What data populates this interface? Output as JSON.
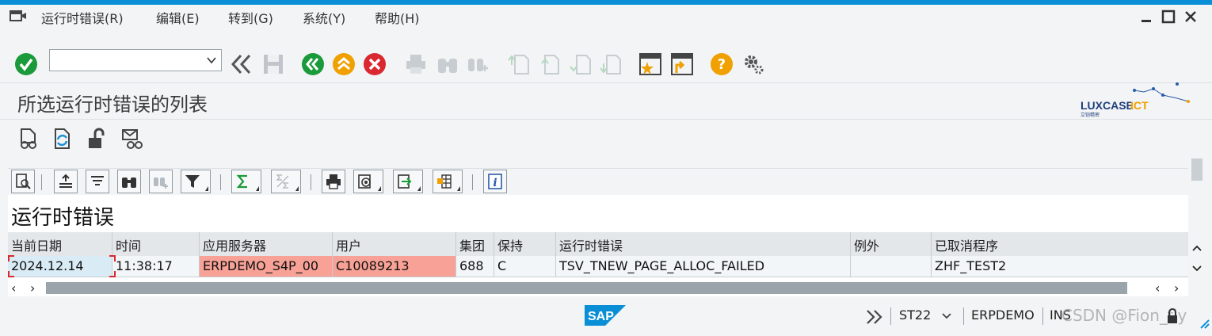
{
  "menu": {
    "items": [
      {
        "label": "运行时错误(R)"
      },
      {
        "label": "编辑(E)"
      },
      {
        "label": "转到(G)"
      },
      {
        "label": "系统(Y)"
      },
      {
        "label": "帮助(H)"
      }
    ]
  },
  "command_field": {
    "value": "",
    "placeholder": ""
  },
  "page": {
    "title": "所选运行时错误的列表"
  },
  "logo": {
    "text": "LUXCASE",
    "text_accent": "ICT",
    "subtext": "立铠精密",
    "accent_color": "#f0a000"
  },
  "list": {
    "title": "运行时错误",
    "columns": [
      "当前日期",
      "时间",
      "应用服务器",
      "用户",
      "集团",
      "保持",
      "运行时错误",
      "例外",
      "已取消程序"
    ],
    "rows": [
      [
        "2024.12.14",
        "11:38:17",
        "ERPDEMO_S4P_00",
        "C10089213",
        "688",
        "C",
        "TSV_TNEW_PAGE_ALLOC_FAILED",
        "",
        "ZHF_TEST2"
      ]
    ]
  },
  "status": {
    "transaction": "ST22",
    "system": "ERPDEMO",
    "mode": "INS",
    "sap_label": "SAP",
    "watermark": "CSDN @Fion_fly"
  },
  "colors": {
    "accent_blue": "#0a8fd6",
    "ok_green": "#1a9a3a",
    "back_green": "#1a9a3a",
    "up_orange": "#f0a000",
    "cancel_red": "#d9282f",
    "help_orange": "#f0a000",
    "highlight_red": "#f8a196"
  }
}
